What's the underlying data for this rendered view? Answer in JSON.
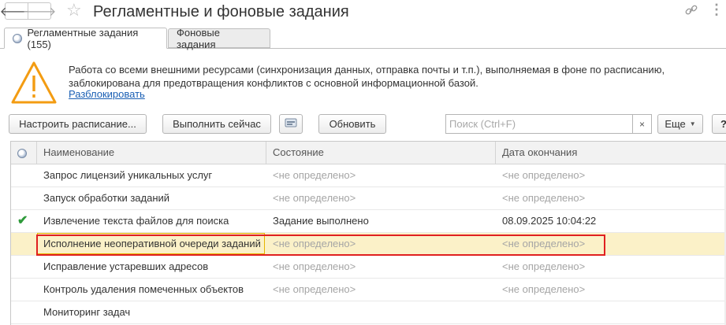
{
  "window": {
    "title": "Регламентные и фоновые задания"
  },
  "nav": {
    "back_icon": "arrow-left-icon",
    "forward_icon": "arrow-right-icon",
    "favorite_icon": "star-icon",
    "link_icon": "link-icon",
    "more_icon": "more-icon"
  },
  "tabs": [
    {
      "label": "Регламентные задания (155)",
      "active": true
    },
    {
      "label": "Фоновые задания",
      "active": false
    }
  ],
  "warning": {
    "line1": "Работа со всеми внешними ресурсами (синхронизация данных, отправка почты и т.п.), выполняемая в фоне по расписанию,",
    "line2": "заблокирована для предотвращения конфликтов с основной информационной базой.",
    "link": "Разблокировать",
    "icon": "warning-triangle-icon"
  },
  "toolbar": {
    "schedule": "Настроить расписание...",
    "run_now": "Выполнить сейчас",
    "refresh": "Обновить",
    "search_placeholder": "Поиск (Ctrl+F)",
    "clear": "×",
    "more": "Еще",
    "help": "?"
  },
  "table": {
    "columns": [
      "Наименование",
      "Состояние",
      "Дата окончания"
    ],
    "rows": [
      {
        "name": "Запрос лицензий уникальных услуг",
        "state": "<не определено>",
        "end": "<не определено>",
        "done": false,
        "selected": false
      },
      {
        "name": "Запуск обработки заданий",
        "state": "<не определено>",
        "end": "<не определено>",
        "done": false,
        "selected": false
      },
      {
        "name": "Извлечение текста файлов для поиска",
        "state": "Задание выполнено",
        "end": "08.09.2025 10:04:22",
        "done": true,
        "selected": false
      },
      {
        "name": "Исполнение неоперативной очереди заданий",
        "state": "<не определено>",
        "end": "<не определено>",
        "done": false,
        "selected": true
      },
      {
        "name": "Исправление устаревших адресов",
        "state": "<не определено>",
        "end": "<не определено>",
        "done": false,
        "selected": false
      },
      {
        "name": "Контроль удаления помеченных объектов",
        "state": "<не определено>",
        "end": "<не определено>",
        "done": false,
        "selected": false
      },
      {
        "name": "Мониторинг задач",
        "state": "",
        "end": "",
        "done": false,
        "selected": false
      }
    ]
  },
  "colors": {
    "warning": "#f39c12",
    "link": "#1a5fb4",
    "selected_row": "#fbf1c8",
    "highlight": "#e02020",
    "check": "#2e9a3a"
  }
}
